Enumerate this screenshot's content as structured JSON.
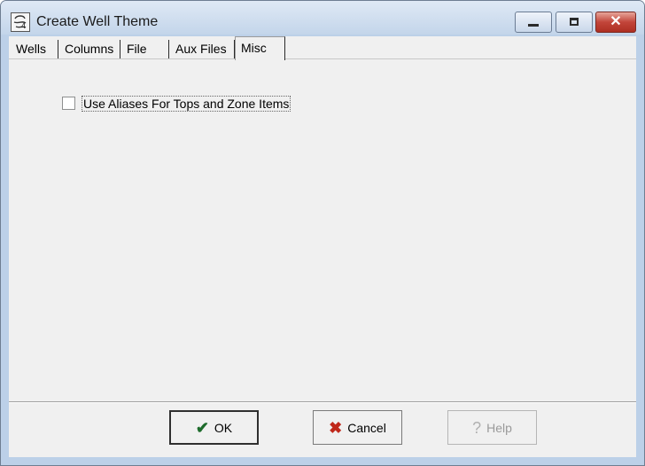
{
  "window": {
    "title": "Create Well Theme",
    "controls": {
      "minimize": "minimize",
      "maximize": "maximize",
      "close": "✕"
    }
  },
  "tabs": [
    {
      "label": "Wells"
    },
    {
      "label": "Columns"
    },
    {
      "label": "File"
    },
    {
      "label": "Aux Files"
    },
    {
      "label": "Misc"
    }
  ],
  "active_tab": "Misc",
  "misc": {
    "use_aliases_label": "Use Aliases For Tops and Zone Items",
    "use_aliases_checked": false
  },
  "buttons": {
    "ok": "OK",
    "cancel": "Cancel",
    "help": "Help"
  },
  "icons": {
    "ok": "check-icon",
    "cancel": "x-icon",
    "help": "question-icon"
  }
}
